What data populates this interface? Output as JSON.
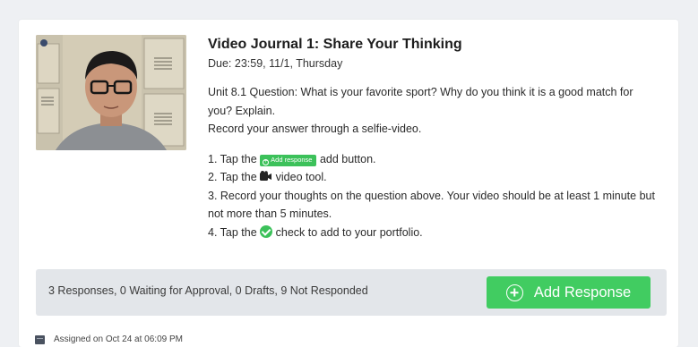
{
  "assignment": {
    "title": "Video Journal 1: Share Your Thinking",
    "due": "Due: 23:59, 11/1, Thursday",
    "question_line1": "Unit 8.1 Question: What is your favorite sport? Why do you think it is a good match for you? Explain.",
    "question_line2": "Record your answer through a selfie-video.",
    "thumbnail_icon": "student-video-thumbnail"
  },
  "steps": {
    "step1_pre": "1. Tap the",
    "step1_pill": "Add response",
    "step1_post": "add button.",
    "step2_pre": "2. Tap the",
    "step2_post": "video tool.",
    "step3": "3. Record your thoughts on the question above. Your video should be at least 1 minute but not more than 5 minutes.",
    "step4_pre": "4. Tap the",
    "step4_post": "check to add to your portfolio."
  },
  "status_bar": {
    "summary": "3 Responses, 0 Waiting for Approval, 0 Drafts, 9 Not Responded",
    "add_button_label": "Add Response"
  },
  "footer": {
    "assigned": "Assigned on Oct 24 at 06:09 PM"
  },
  "colors": {
    "accent_green": "#41cc61",
    "bar_background": "#e3e6ea",
    "page_background": "#eef0f3"
  }
}
